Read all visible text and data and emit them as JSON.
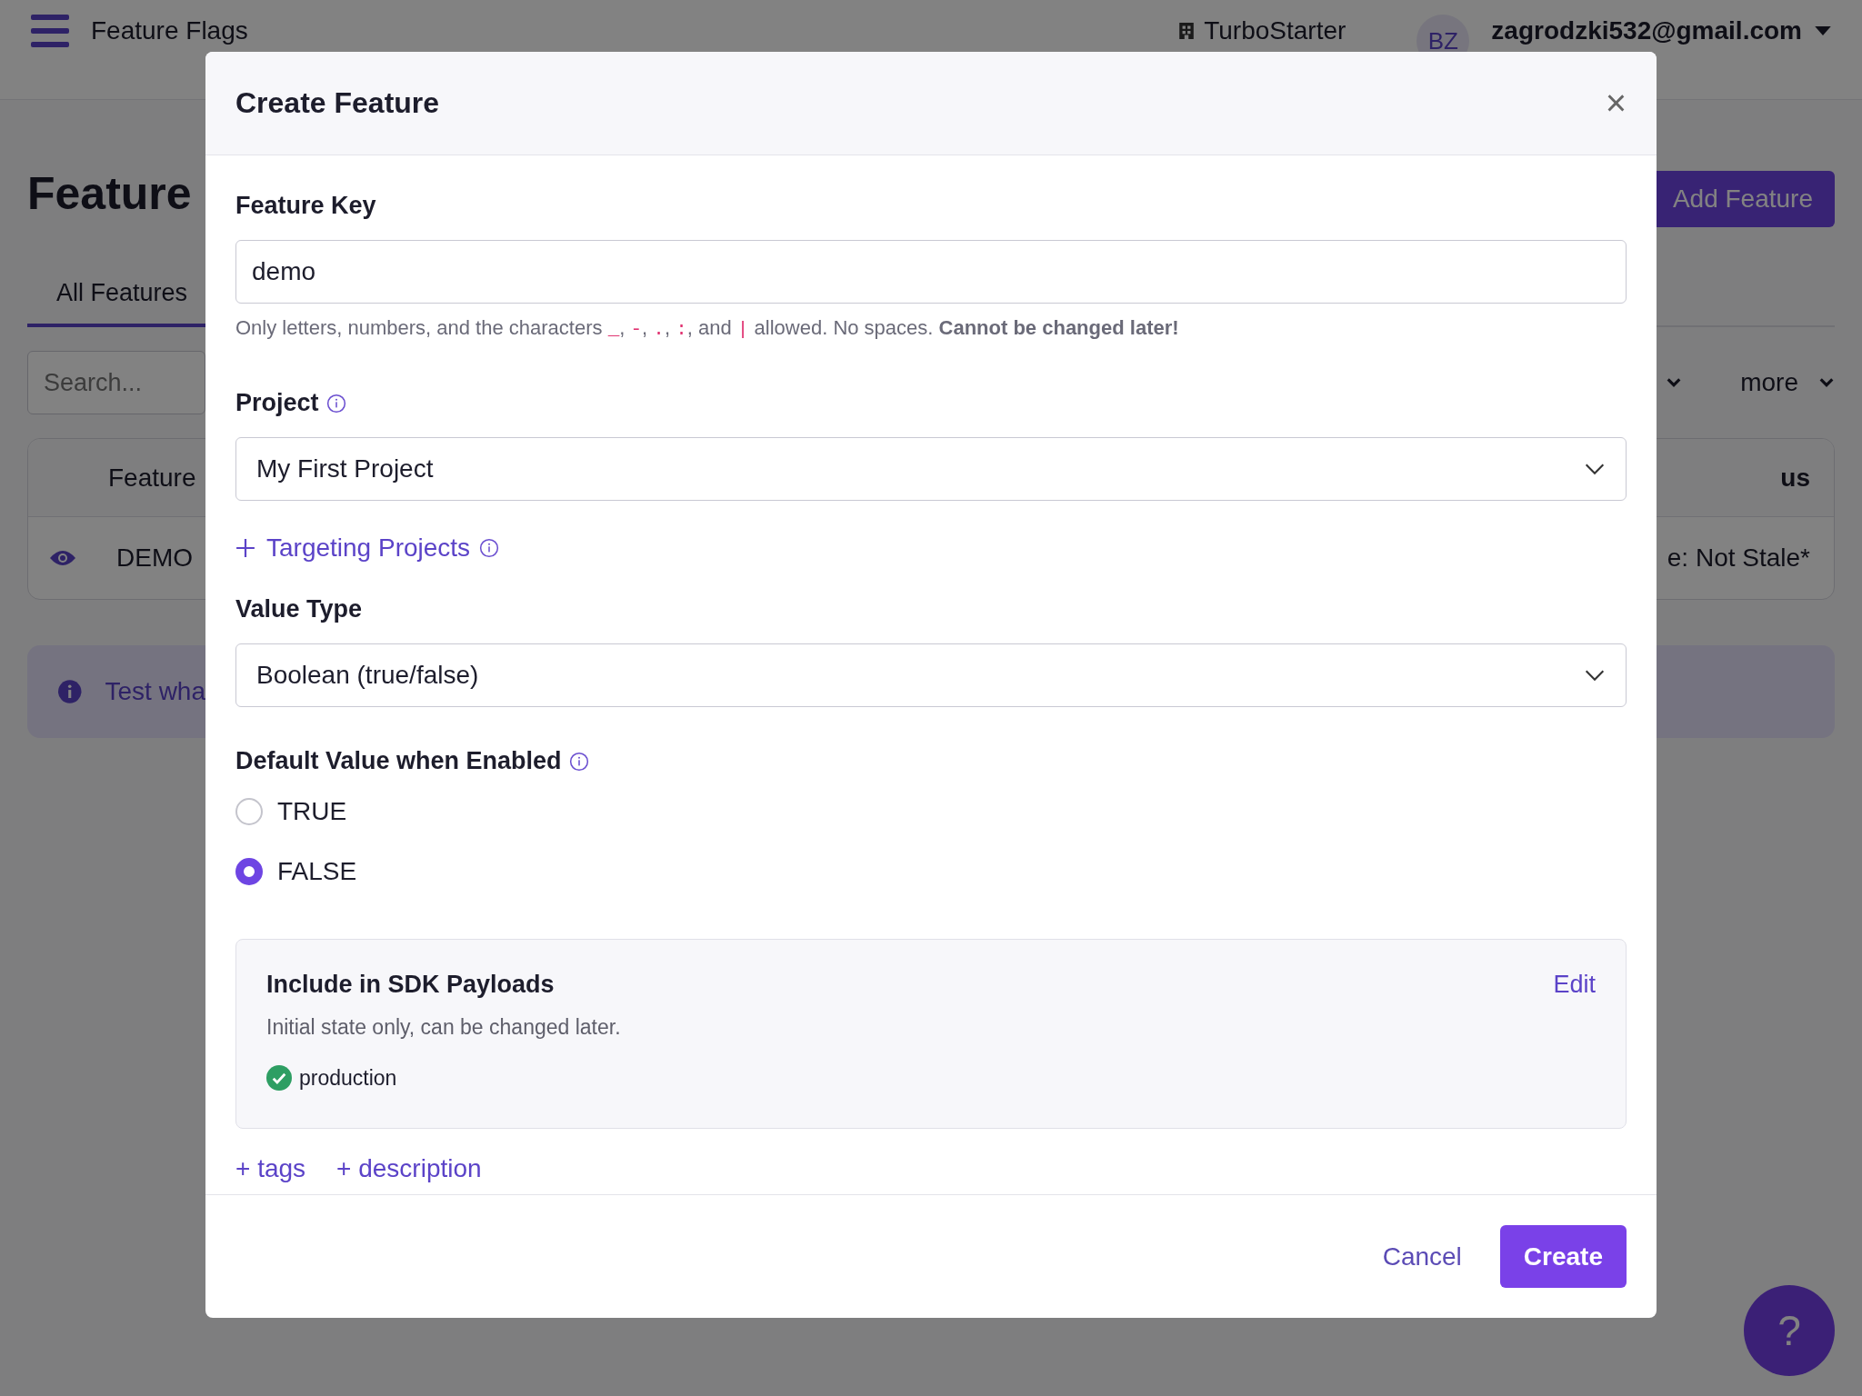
{
  "top_bar": {
    "title": "Feature Flags",
    "org": "TurboStarter",
    "avatar_initials": "BZ",
    "user_email": "zagrodzki532@gmail.com"
  },
  "page": {
    "title": "Feature",
    "add_button": "Add Feature",
    "tabs": [
      {
        "label": "All Features",
        "selected": true
      }
    ],
    "search": {
      "placeholder": "Search..."
    },
    "more_filter": "more",
    "table": {
      "columns": [
        "Feature",
        "us"
      ],
      "rows": [
        {
          "cells": [
            "DEMO",
            "e: Not Stale*"
          ]
        }
      ]
    },
    "banner": "Test wha",
    "help_button": "?"
  },
  "modal": {
    "title": "Create Feature",
    "close": "×",
    "feature_key": {
      "label": "Feature Key",
      "value": "demo",
      "help": [
        {
          "kind": "plain",
          "text": "Only letters, numbers, and the characters "
        },
        {
          "kind": "code",
          "text": "_"
        },
        {
          "kind": "plain",
          "text": ", "
        },
        {
          "kind": "code",
          "text": "-"
        },
        {
          "kind": "plain",
          "text": ", "
        },
        {
          "kind": "code",
          "text": "."
        },
        {
          "kind": "plain",
          "text": ", "
        },
        {
          "kind": "code",
          "text": ":"
        },
        {
          "kind": "plain",
          "text": ", and "
        },
        {
          "kind": "code",
          "text": "|"
        },
        {
          "kind": "plain",
          "text": " allowed. No spaces. "
        },
        {
          "kind": "bold",
          "text": "Cannot be changed later!"
        }
      ]
    },
    "project": {
      "label": "Project",
      "value": "My First Project"
    },
    "targeting_link": "Targeting Projects",
    "value_type": {
      "label": "Value Type",
      "value": "Boolean (true/false)"
    },
    "default_value": {
      "label": "Default Value when Enabled",
      "options": [
        {
          "label": "TRUE",
          "selected": false
        },
        {
          "label": "FALSE",
          "selected": true
        }
      ]
    },
    "sdk": {
      "title": "Include in SDK Payloads",
      "subtitle": "Initial state only, can be changed later.",
      "edit": "Edit",
      "environments": [
        {
          "name": "production",
          "enabled": true
        }
      ]
    },
    "extra_links": [
      "+ tags",
      "+ description"
    ],
    "cancel": "Cancel",
    "create": "Create"
  }
}
